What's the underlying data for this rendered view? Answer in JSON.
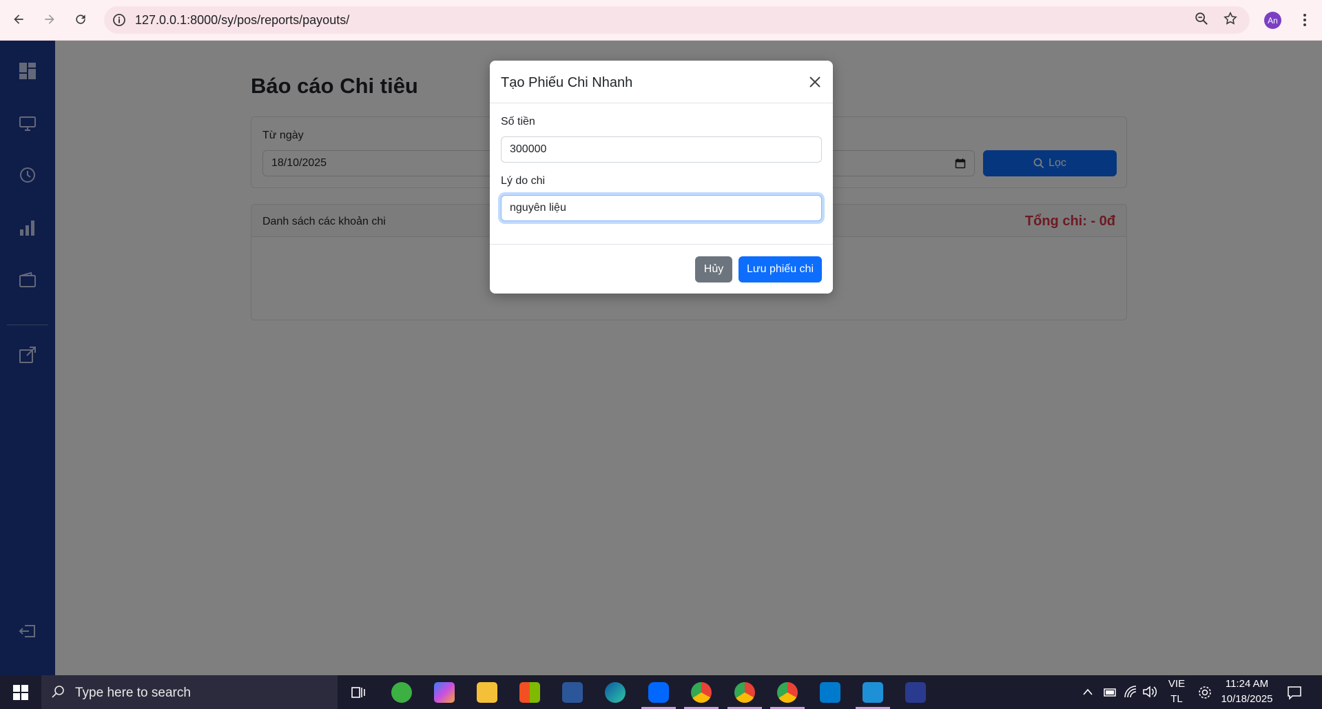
{
  "browser": {
    "url": "127.0.0.1:8000/sy/pos/reports/payouts/",
    "profile_initials": "An"
  },
  "page": {
    "title": "Báo cáo Chi tiêu",
    "filter": {
      "from_label": "Từ ngày",
      "from_value": "18/10/2025",
      "filter_button": "Lọc"
    },
    "list": {
      "title": "Danh sách các khoản chi",
      "total": "Tổng chi: - 0đ"
    }
  },
  "modal": {
    "title": "Tạo Phiếu Chi Nhanh",
    "amount_label": "Số tiền",
    "amount_value": "300000",
    "reason_label": "Lý do chi",
    "reason_value": "nguyên liệu",
    "cancel_button": "Hủy",
    "save_button": "Lưu phiếu chi"
  },
  "taskbar": {
    "search_placeholder": "Type here to search",
    "language": "VIE",
    "layout": "TL",
    "time": "11:24 AM",
    "date": "10/18/2025"
  },
  "colors": {
    "sidebar": "#1f3a93",
    "primary": "#0d6efd",
    "danger": "#dc3545",
    "secondary": "#6c757d"
  }
}
